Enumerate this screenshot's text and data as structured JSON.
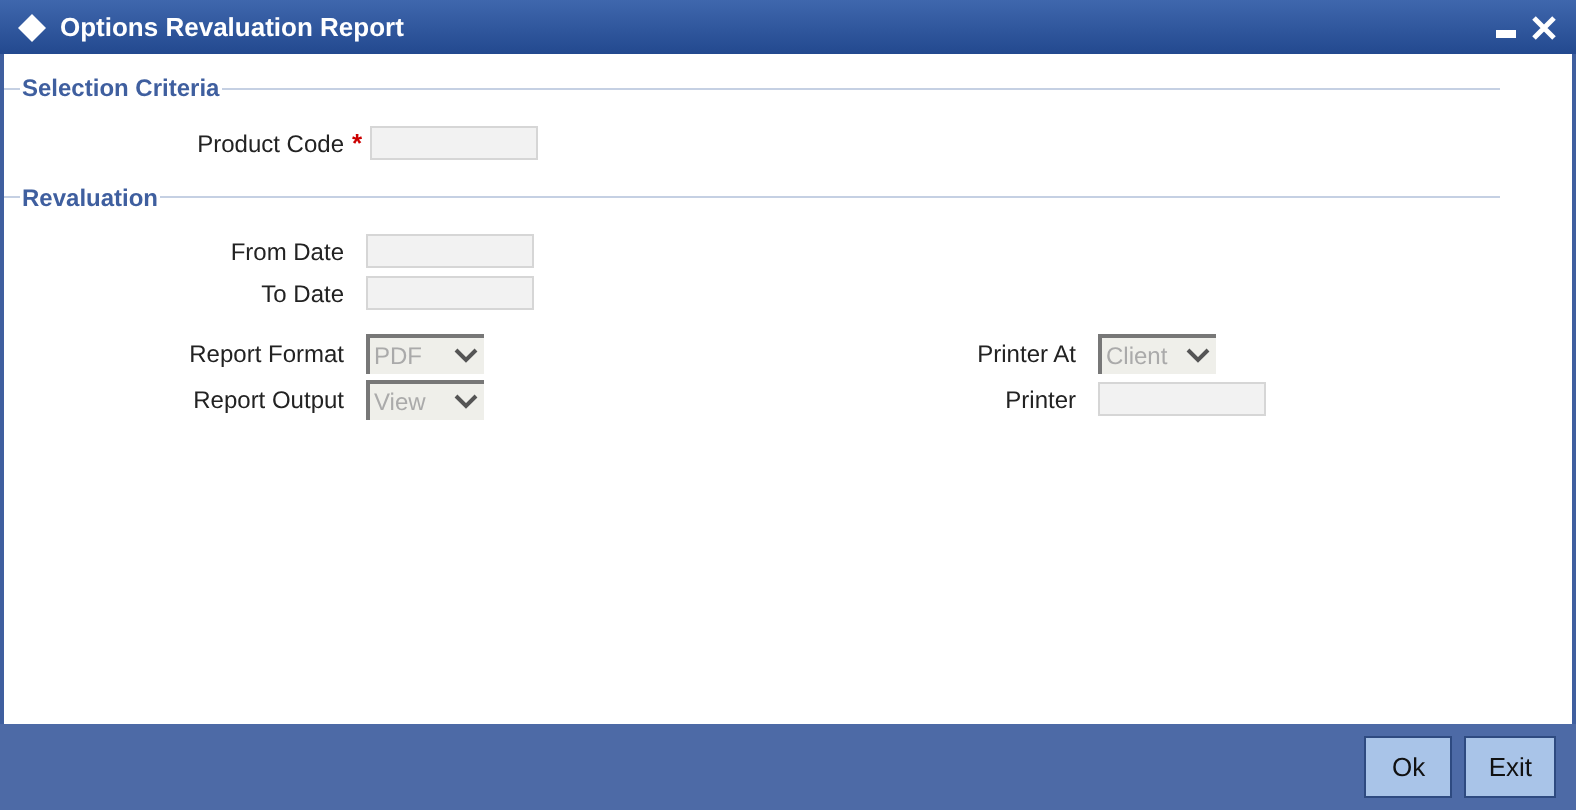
{
  "window": {
    "title": "Options Revaluation Report"
  },
  "sections": [
    {
      "title": "Selection Criteria",
      "rows": [
        [
          {
            "kind": "code",
            "label": "Product Code",
            "required": true
          }
        ]
      ]
    },
    {
      "title": "Revaluation",
      "rows": [
        [
          {
            "kind": "date",
            "label": "From Date",
            "required": false
          }
        ],
        [
          {
            "kind": "date",
            "label": "To Date",
            "required": false
          }
        ],
        [
          {
            "kind": "select",
            "label": "Report Format",
            "value": "PDF"
          },
          {
            "kind": "select",
            "label": "Printer At",
            "value": "Client"
          }
        ],
        [
          {
            "kind": "select",
            "label": "Report Output",
            "value": "View"
          },
          {
            "kind": "text",
            "label": "Printer",
            "required": false
          }
        ]
      ]
    }
  ],
  "required_mark": "*",
  "buttons": [
    "Ok",
    "Exit"
  ]
}
